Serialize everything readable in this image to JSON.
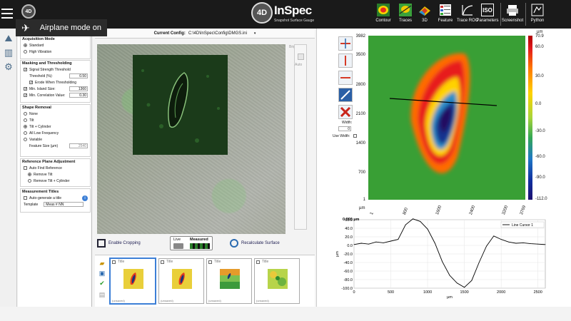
{
  "titlebar": {
    "app_name": "InSpec",
    "app_badge": "4D",
    "app_subtitle": "Snapshot Surface Gauge",
    "mini_logo": "4D",
    "toast": "Airplane mode on",
    "buttons": [
      {
        "label": "Contour",
        "icon": "contour-icon"
      },
      {
        "label": "Traces",
        "icon": "traces-icon"
      },
      {
        "label": "3D",
        "icon": "3d-icon"
      },
      {
        "label": "Feature",
        "icon": "feature-icon"
      },
      {
        "label": "Trace ROC",
        "icon": "trace-roc-icon"
      },
      {
        "label": "Parameters",
        "icon": "parameters-icon",
        "glyph": "ISO"
      },
      {
        "label": "Screenshot",
        "icon": "screenshot-icon"
      },
      {
        "label": "Python",
        "icon": "python-icon"
      }
    ]
  },
  "settings": {
    "acquisition": {
      "title": "Acquisition Mode",
      "options": [
        "Standard",
        "High Vibration"
      ],
      "selected": 0
    },
    "masking": {
      "title": "Masking and Thresholding",
      "signal_strength": "Signal Strength Threshold",
      "threshold_label": "Threshold (%):",
      "threshold_value": "0.50",
      "erode": "Erode When Thresholding",
      "min_island_label": "Min. Island Size:",
      "min_island_value": "1360",
      "min_corr_label": "Min. Correlation Value:",
      "min_corr_value": "0.30"
    },
    "shape": {
      "title": "Shape Removal",
      "options": [
        "None",
        "Tilt",
        "Tilt + Cylinder",
        "All Low Frequency",
        "Variable"
      ],
      "selected": 2,
      "feature_size_label": "Feature Size (µm)",
      "feature_size_value": "2540"
    },
    "reference": {
      "title": "Reference Plane Adjustment",
      "auto_find": "Auto Find Reference",
      "options": [
        "Remove Tilt",
        "Remove Tilt + Cylinder"
      ],
      "selected": 0
    },
    "titles": {
      "title": "Measurement Titles",
      "auto_generate": "Auto-generate a title",
      "template_label": "Template",
      "template_value": "Meas # NN"
    }
  },
  "config": {
    "label": "Current Config:",
    "path": "C:\\4D\\InSpec\\Config\\DMGS.ini"
  },
  "camera": {
    "brightness_label": "Brightness",
    "auto_label": "Auto",
    "enable_cropping": "Enable Cropping",
    "live": "Live",
    "measured": "Measured",
    "recalculate": "Recalculate Surface"
  },
  "thumbnails": [
    {
      "title": "Title",
      "status": "(unsaved)"
    },
    {
      "title": "Title",
      "status": "(unsaved)"
    },
    {
      "title": "Title",
      "status": "(unsaved)"
    },
    {
      "title": "Title",
      "status": "(unsaved)"
    }
  ],
  "heatmap": {
    "unit": "µm",
    "x_unit": "µm",
    "y_ticks": [
      "3982",
      "3500",
      "2800",
      "2100",
      "1400",
      "700",
      "1"
    ],
    "x_ticks": [
      "1",
      "800",
      "1600",
      "2400",
      "3200",
      "3769"
    ],
    "colorbar_ticks": [
      "70.9",
      "60.0",
      "30.0",
      "0.0",
      "-30.0",
      "-60.0",
      "-90.0",
      "-112.0"
    ],
    "width_label": "Width:",
    "width_value": "0",
    "use_width_label": "Use Width:"
  },
  "chart_data": {
    "type": "line",
    "title": "0.000 µm",
    "xlabel": "µm",
    "ylabel": "µm",
    "xlim": [
      0,
      2600
    ],
    "ylim": [
      -100,
      60
    ],
    "x_ticks": [
      0,
      500,
      1000,
      1500,
      2000,
      2500
    ],
    "y_ticks": [
      60,
      40,
      20,
      0,
      -20,
      -40,
      -60,
      -80,
      -100
    ],
    "legend": "top-right",
    "series": [
      {
        "name": "Line Cursor 1",
        "x": [
          0,
          100,
          200,
          300,
          400,
          500,
          600,
          700,
          800,
          900,
          1000,
          1100,
          1200,
          1300,
          1400,
          1500,
          1600,
          1700,
          1800,
          1900,
          2000,
          2100,
          2200,
          2300,
          2400,
          2500,
          2600
        ],
        "values": [
          2,
          5,
          3,
          8,
          6,
          10,
          14,
          48,
          62,
          56,
          38,
          5,
          -38,
          -70,
          -88,
          -98,
          -82,
          -40,
          -2,
          22,
          14,
          8,
          5,
          6,
          4,
          3,
          2
        ]
      }
    ]
  }
}
